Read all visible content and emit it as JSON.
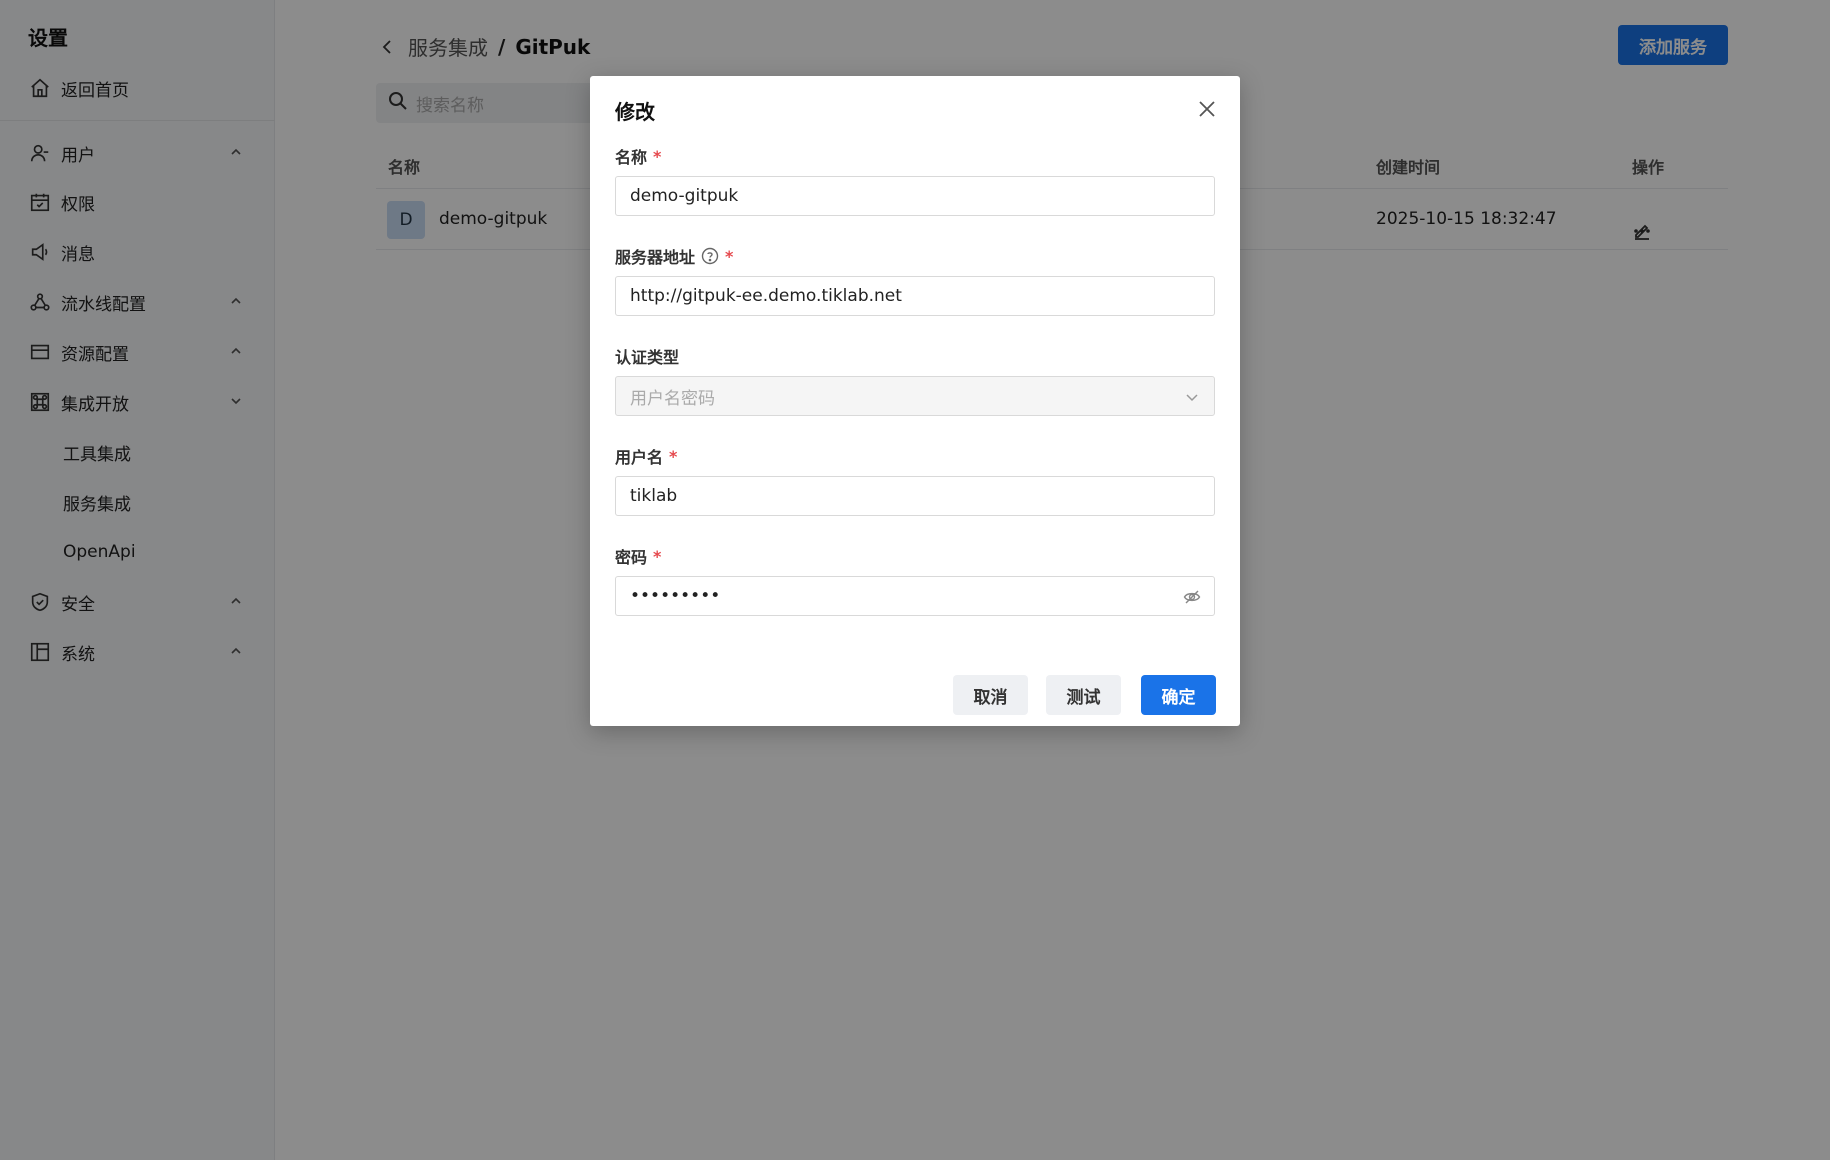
{
  "sidebar": {
    "title": "设置",
    "home_label": "返回首页",
    "items": [
      {
        "label": "用户",
        "icon": "user-icon",
        "chevron": "up"
      },
      {
        "label": "权限",
        "icon": "calendar-check-icon",
        "chevron": ""
      },
      {
        "label": "消息",
        "icon": "megaphone-icon",
        "chevron": ""
      },
      {
        "label": "流水线配置",
        "icon": "flow-icon",
        "chevron": "up"
      },
      {
        "label": "资源配置",
        "icon": "card-icon",
        "chevron": "up"
      },
      {
        "label": "集成开放",
        "icon": "command-icon",
        "chevron": "down"
      },
      {
        "label": "安全",
        "icon": "shield-icon",
        "chevron": "up"
      },
      {
        "label": "系统",
        "icon": "layout-icon",
        "chevron": "up"
      }
    ],
    "subitems": [
      "工具集成",
      "服务集成",
      "OpenApi"
    ]
  },
  "header": {
    "breadcrumb_parent": "服务集成",
    "breadcrumb_sep": "/",
    "breadcrumb_current": "GitPuk",
    "add_button": "添加服务"
  },
  "search": {
    "placeholder": "搜索名称"
  },
  "table": {
    "columns": {
      "name": "名称",
      "created": "创建时间",
      "actions": "操作"
    },
    "rows": [
      {
        "avatar": "D",
        "name": "demo-gitpuk",
        "created": "2025-10-15 18:32:47"
      }
    ]
  },
  "modal": {
    "title": "修改",
    "fields": {
      "name": {
        "label": "名称",
        "value": "demo-gitpuk"
      },
      "server": {
        "label": "服务器地址",
        "value": "http://gitpuk-ee.demo.tiklab.net"
      },
      "auth": {
        "label": "认证类型",
        "value": "用户名密码"
      },
      "username": {
        "label": "用户名",
        "value": "tiklab"
      },
      "password": {
        "label": "密码",
        "value": "•••••••••"
      }
    },
    "required_mark": "*",
    "buttons": {
      "cancel": "取消",
      "test": "测试",
      "confirm": "确定"
    }
  },
  "colors": {
    "primary": "#1a73e8",
    "required": "#e5484d",
    "overlay": "rgba(0,0,0,0.45)"
  }
}
